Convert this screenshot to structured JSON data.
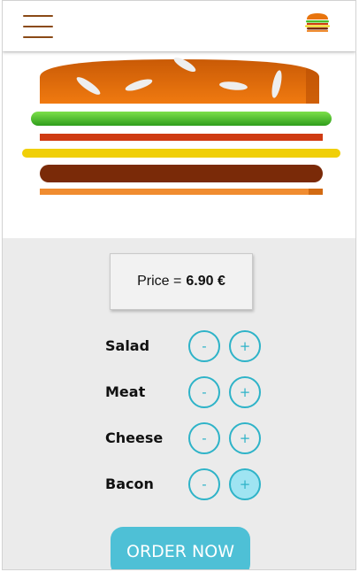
{
  "toolbar": {
    "menu_icon": "hamburger-menu-icon",
    "logo_icon": "burger-logo-icon"
  },
  "burger": {
    "layers": [
      "bun-top",
      "salad",
      "bacon",
      "cheese",
      "meat",
      "bun-bottom"
    ]
  },
  "price": {
    "label": "Price = ",
    "value": "6.90 €"
  },
  "ingredients": [
    {
      "label": "Salad",
      "minus": "-",
      "plus": "+"
    },
    {
      "label": "Meat",
      "minus": "-",
      "plus": "+"
    },
    {
      "label": "Cheese",
      "minus": "-",
      "plus": "+"
    },
    {
      "label": "Bacon",
      "minus": "-",
      "plus": "+"
    }
  ],
  "order_button": {
    "label": "ORDER NOW"
  },
  "colors": {
    "accent": "#2eb3c8",
    "order_button": "#4ec0d6",
    "bun": "#e8740c",
    "salad": "#4bbf2a",
    "bacon": "#cf3b12",
    "cheese": "#f0cf08",
    "meat": "#7a2a08",
    "menu_icon": "#8a4a16"
  }
}
